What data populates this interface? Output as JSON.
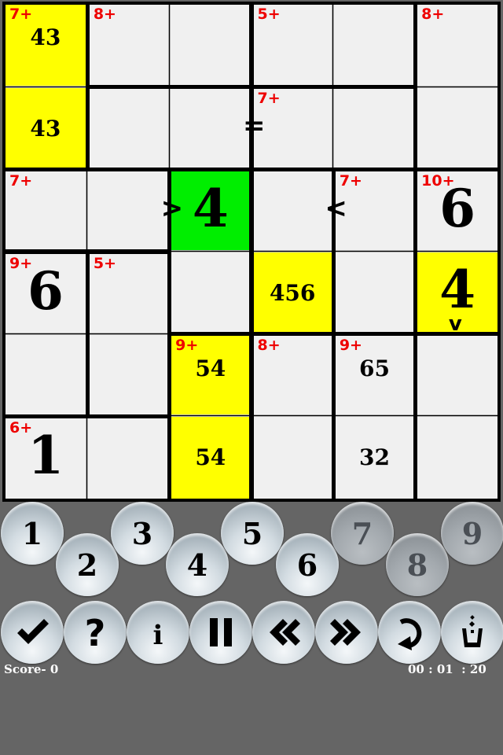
{
  "board": {
    "size": 6,
    "colors": {
      "cell": "#f0f0f0",
      "selected": "#ffff00",
      "active": "#00ee00",
      "clue": "#ee0000"
    },
    "cells": [
      {
        "r": 0,
        "c": 0,
        "clue": "7+",
        "value": "43",
        "kind": "notes",
        "highlight": "yellow"
      },
      {
        "r": 0,
        "c": 1,
        "clue": "8+",
        "value": "",
        "kind": "empty",
        "highlight": ""
      },
      {
        "r": 0,
        "c": 2,
        "clue": "",
        "value": "",
        "kind": "empty",
        "highlight": ""
      },
      {
        "r": 0,
        "c": 3,
        "clue": "5+",
        "value": "",
        "kind": "empty",
        "highlight": ""
      },
      {
        "r": 0,
        "c": 4,
        "clue": "",
        "value": "",
        "kind": "empty",
        "highlight": ""
      },
      {
        "r": 0,
        "c": 5,
        "clue": "8+",
        "value": "",
        "kind": "empty",
        "highlight": ""
      },
      {
        "r": 1,
        "c": 0,
        "clue": "",
        "value": "43",
        "kind": "notes",
        "highlight": "yellow"
      },
      {
        "r": 1,
        "c": 1,
        "clue": "",
        "value": "",
        "kind": "empty",
        "highlight": ""
      },
      {
        "r": 1,
        "c": 2,
        "clue": "",
        "value": "",
        "kind": "empty",
        "highlight": ""
      },
      {
        "r": 1,
        "c": 3,
        "clue": "7+",
        "value": "",
        "kind": "empty",
        "highlight": ""
      },
      {
        "r": 1,
        "c": 4,
        "clue": "",
        "value": "",
        "kind": "empty",
        "highlight": ""
      },
      {
        "r": 1,
        "c": 5,
        "clue": "",
        "value": "",
        "kind": "empty",
        "highlight": ""
      },
      {
        "r": 2,
        "c": 0,
        "clue": "7+",
        "value": "",
        "kind": "empty",
        "highlight": ""
      },
      {
        "r": 2,
        "c": 1,
        "clue": "",
        "value": "",
        "kind": "empty",
        "highlight": ""
      },
      {
        "r": 2,
        "c": 2,
        "clue": "",
        "value": "4",
        "kind": "final",
        "highlight": "green"
      },
      {
        "r": 2,
        "c": 3,
        "clue": "",
        "value": "",
        "kind": "empty",
        "highlight": ""
      },
      {
        "r": 2,
        "c": 4,
        "clue": "7+",
        "value": "",
        "kind": "empty",
        "highlight": ""
      },
      {
        "r": 2,
        "c": 5,
        "clue": "10+",
        "value": "6",
        "kind": "final",
        "highlight": ""
      },
      {
        "r": 3,
        "c": 0,
        "clue": "9+",
        "value": "6",
        "kind": "final",
        "highlight": ""
      },
      {
        "r": 3,
        "c": 1,
        "clue": "5+",
        "value": "",
        "kind": "empty",
        "highlight": ""
      },
      {
        "r": 3,
        "c": 2,
        "clue": "",
        "value": "",
        "kind": "empty",
        "highlight": ""
      },
      {
        "r": 3,
        "c": 3,
        "clue": "",
        "value": "456",
        "kind": "notes",
        "highlight": "yellow"
      },
      {
        "r": 3,
        "c": 4,
        "clue": "",
        "value": "",
        "kind": "empty",
        "highlight": ""
      },
      {
        "r": 3,
        "c": 5,
        "clue": "",
        "value": "4",
        "kind": "final",
        "highlight": "yellow"
      },
      {
        "r": 4,
        "c": 0,
        "clue": "",
        "value": "",
        "kind": "empty",
        "highlight": ""
      },
      {
        "r": 4,
        "c": 1,
        "clue": "",
        "value": "",
        "kind": "empty",
        "highlight": ""
      },
      {
        "r": 4,
        "c": 2,
        "clue": "9+",
        "value": "54",
        "kind": "notes",
        "highlight": "yellow"
      },
      {
        "r": 4,
        "c": 3,
        "clue": "8+",
        "value": "",
        "kind": "empty",
        "highlight": ""
      },
      {
        "r": 4,
        "c": 4,
        "clue": "9+",
        "value": "65",
        "kind": "notes",
        "highlight": ""
      },
      {
        "r": 4,
        "c": 5,
        "clue": "",
        "value": "",
        "kind": "empty",
        "highlight": ""
      },
      {
        "r": 5,
        "c": 0,
        "clue": "6+",
        "value": "1",
        "kind": "final",
        "highlight": ""
      },
      {
        "r": 5,
        "c": 1,
        "clue": "",
        "value": "",
        "kind": "empty",
        "highlight": ""
      },
      {
        "r": 5,
        "c": 2,
        "clue": "",
        "value": "54",
        "kind": "notes",
        "highlight": "yellow"
      },
      {
        "r": 5,
        "c": 3,
        "clue": "",
        "value": "",
        "kind": "empty",
        "highlight": ""
      },
      {
        "r": 5,
        "c": 4,
        "clue": "",
        "value": "32",
        "kind": "notes",
        "highlight": ""
      },
      {
        "r": 5,
        "c": 5,
        "clue": "",
        "value": "",
        "kind": "empty",
        "highlight": ""
      }
    ],
    "cages": [
      [
        [
          0,
          0
        ],
        [
          1,
          0
        ]
      ],
      [
        [
          0,
          1
        ],
        [
          0,
          2
        ]
      ],
      [
        [
          0,
          3
        ],
        [
          0,
          4
        ]
      ],
      [
        [
          0,
          5
        ],
        [
          1,
          5
        ]
      ],
      [
        [
          1,
          1
        ],
        [
          1,
          2
        ]
      ],
      [
        [
          1,
          3
        ],
        [
          1,
          4
        ]
      ],
      [
        [
          2,
          0
        ],
        [
          2,
          1
        ]
      ],
      [
        [
          2,
          2
        ],
        [
          3,
          2
        ]
      ],
      [
        [
          2,
          3
        ],
        [
          3,
          3
        ]
      ],
      [
        [
          2,
          4
        ],
        [
          3,
          4
        ]
      ],
      [
        [
          2,
          5
        ],
        [
          3,
          5
        ]
      ],
      [
        [
          3,
          0
        ],
        [
          4,
          0
        ]
      ],
      [
        [
          3,
          1
        ],
        [
          4,
          1
        ]
      ],
      [
        [
          4,
          2
        ],
        [
          5,
          2
        ]
      ],
      [
        [
          4,
          3
        ],
        [
          5,
          3
        ]
      ],
      [
        [
          4,
          4
        ],
        [
          5,
          4
        ]
      ],
      [
        [
          4,
          5
        ],
        [
          5,
          5
        ]
      ],
      [
        [
          5,
          0
        ],
        [
          5,
          1
        ]
      ]
    ],
    "constraints": [
      {
        "between": [
          [
            1,
            2
          ],
          [
            1,
            3
          ]
        ],
        "symbol": "=",
        "orientation": "horizontal"
      },
      {
        "between": [
          [
            2,
            1
          ],
          [
            2,
            2
          ]
        ],
        "symbol": ">",
        "orientation": "horizontal"
      },
      {
        "between": [
          [
            2,
            3
          ],
          [
            2,
            4
          ]
        ],
        "symbol": "<",
        "orientation": "horizontal"
      },
      {
        "between": [
          [
            3,
            5
          ],
          [
            4,
            5
          ]
        ],
        "symbol": "v",
        "orientation": "vertical"
      }
    ]
  },
  "keypad": {
    "digits": [
      {
        "label": "1",
        "enabled": true
      },
      {
        "label": "2",
        "enabled": true
      },
      {
        "label": "3",
        "enabled": true
      },
      {
        "label": "4",
        "enabled": true
      },
      {
        "label": "5",
        "enabled": true
      },
      {
        "label": "6",
        "enabled": true
      },
      {
        "label": "7",
        "enabled": false
      },
      {
        "label": "8",
        "enabled": false
      },
      {
        "label": "9",
        "enabled": false
      }
    ]
  },
  "toolbar": {
    "buttons": [
      {
        "name": "check",
        "icon": "checkmark-icon"
      },
      {
        "name": "hint",
        "icon": "question-icon"
      },
      {
        "name": "info",
        "icon": "info-icon"
      },
      {
        "name": "pause",
        "icon": "pause-icon"
      },
      {
        "name": "undo",
        "icon": "double-left-chevron-icon"
      },
      {
        "name": "redo",
        "icon": "double-right-chevron-icon"
      },
      {
        "name": "restart",
        "icon": "rotate-icon"
      },
      {
        "name": "clear",
        "icon": "trash-cup-icon"
      }
    ]
  },
  "status": {
    "score_label": "Score- ",
    "score_value": "0",
    "timer": "00 : 01  : 20"
  }
}
